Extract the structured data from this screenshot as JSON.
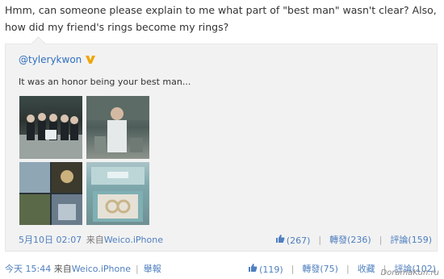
{
  "post": {
    "text": "Hmm, can someone please explain to me what part of \"best man\" wasn't clear? Also, how did my friend's rings become my rings?"
  },
  "repost": {
    "author": "@tylerykwon",
    "text": "It was an honor being your best man...",
    "date": "5月10日 02:07",
    "source_prefix": "来自",
    "source": "Weico.iPhone",
    "stats": {
      "likes": "(267)",
      "repost_label": "轉發",
      "repost_count": "(236)",
      "comment_label": "評論",
      "comment_count": "(159)"
    }
  },
  "footer": {
    "time": "今天 15:44",
    "source_prefix": "来自",
    "source": "Weico.iPhone",
    "report": "舉報",
    "likes": "(119)",
    "repost_label": "轉發",
    "repost_count": "(75)",
    "collect_label": "收藏",
    "comment_label": "評論",
    "comment_count": "(102)"
  },
  "watermark": "DoramaKun.ru",
  "colors": {
    "link": "#4f7fbf",
    "username": "#2f6fc0",
    "badge": "#f0a500"
  }
}
